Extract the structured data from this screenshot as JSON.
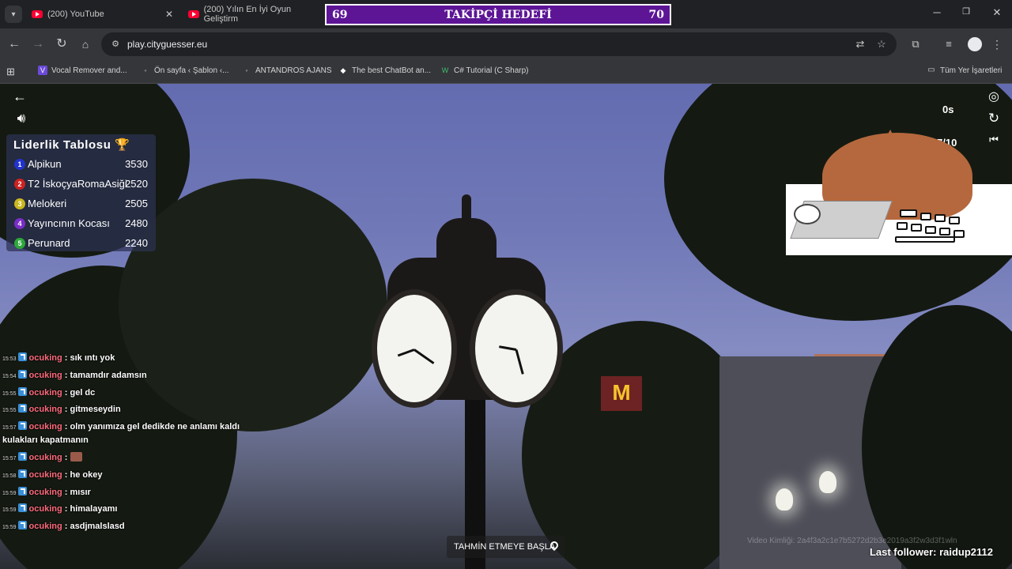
{
  "tabs": [
    {
      "label": "(200) YouTube"
    },
    {
      "label": "(200) Yılın En İyi Oyun Geliştirm"
    }
  ],
  "follower_goal": {
    "current": "69",
    "title": "TAKİPÇİ HEDEFİ",
    "target": "70"
  },
  "address_bar": {
    "url": "play.cityguesser.eu"
  },
  "bookmarks": [
    {
      "label": "Vocal Remover and..."
    },
    {
      "label": "Ön sayfa ‹ Şablon ‹..."
    },
    {
      "label": "ANTANDROS AJANS"
    },
    {
      "label": "The best ChatBot an..."
    },
    {
      "label": "C# Tutorial (C Sharp)"
    }
  ],
  "all_bookmarks_label": "Tüm Yer İşaretleri",
  "game": {
    "timer": "0s",
    "round": "7/10",
    "guess_button": "TAHMİN ETMEYE BAŞLA",
    "video_id": "Video Kimliği: 2a4f3a2c1e7b5272d2b3e2019a3f2w3d3f1wln"
  },
  "leaderboard": {
    "title": "Liderlik Tablosu 🏆",
    "rows": [
      {
        "rank": "1",
        "name": "Alpikun",
        "score": "3530",
        "color": "#2233cc"
      },
      {
        "rank": "2",
        "name": "T2 İskoçyaRomaAsiği",
        "score": "2520",
        "color": "#cc2222"
      },
      {
        "rank": "3",
        "name": "Melokeri",
        "score": "2505",
        "color": "#c9b71d"
      },
      {
        "rank": "4",
        "name": "Yayıncının Kocası",
        "score": "2480",
        "color": "#7a2dc7"
      },
      {
        "rank": "5",
        "name": "Perunard",
        "score": "2240",
        "color": "#2da83a"
      }
    ]
  },
  "chat": [
    {
      "time": "15:53",
      "user": "ocuking",
      "text": ": sık ıntı yok"
    },
    {
      "time": "15:54",
      "user": "ocuking",
      "text": ": tamamdır adamsın"
    },
    {
      "time": "15:55",
      "user": "ocuking",
      "text": ": gel dc"
    },
    {
      "time": "15:55",
      "user": "ocuking",
      "text": ": gitmeseydin"
    },
    {
      "time": "15:57",
      "user": "ocuking",
      "text": ": olm yanımıza gel dedikde ne anlamı kaldı"
    },
    {
      "time": "",
      "user": "",
      "text": "kulakları kapatmanın"
    },
    {
      "time": "15:57",
      "user": "ocuking",
      "text": ":"
    },
    {
      "time": "15:58",
      "user": "ocuking",
      "text": ": he okey"
    },
    {
      "time": "15:59",
      "user": "ocuking",
      "text": ": mısır"
    },
    {
      "time": "15:59",
      "user": "ocuking",
      "text": ": himalayamı"
    },
    {
      "time": "15:59",
      "user": "ocuking",
      "text": ": asdjmalslasd"
    }
  ],
  "last_follower": "Last follower: raidup2112"
}
